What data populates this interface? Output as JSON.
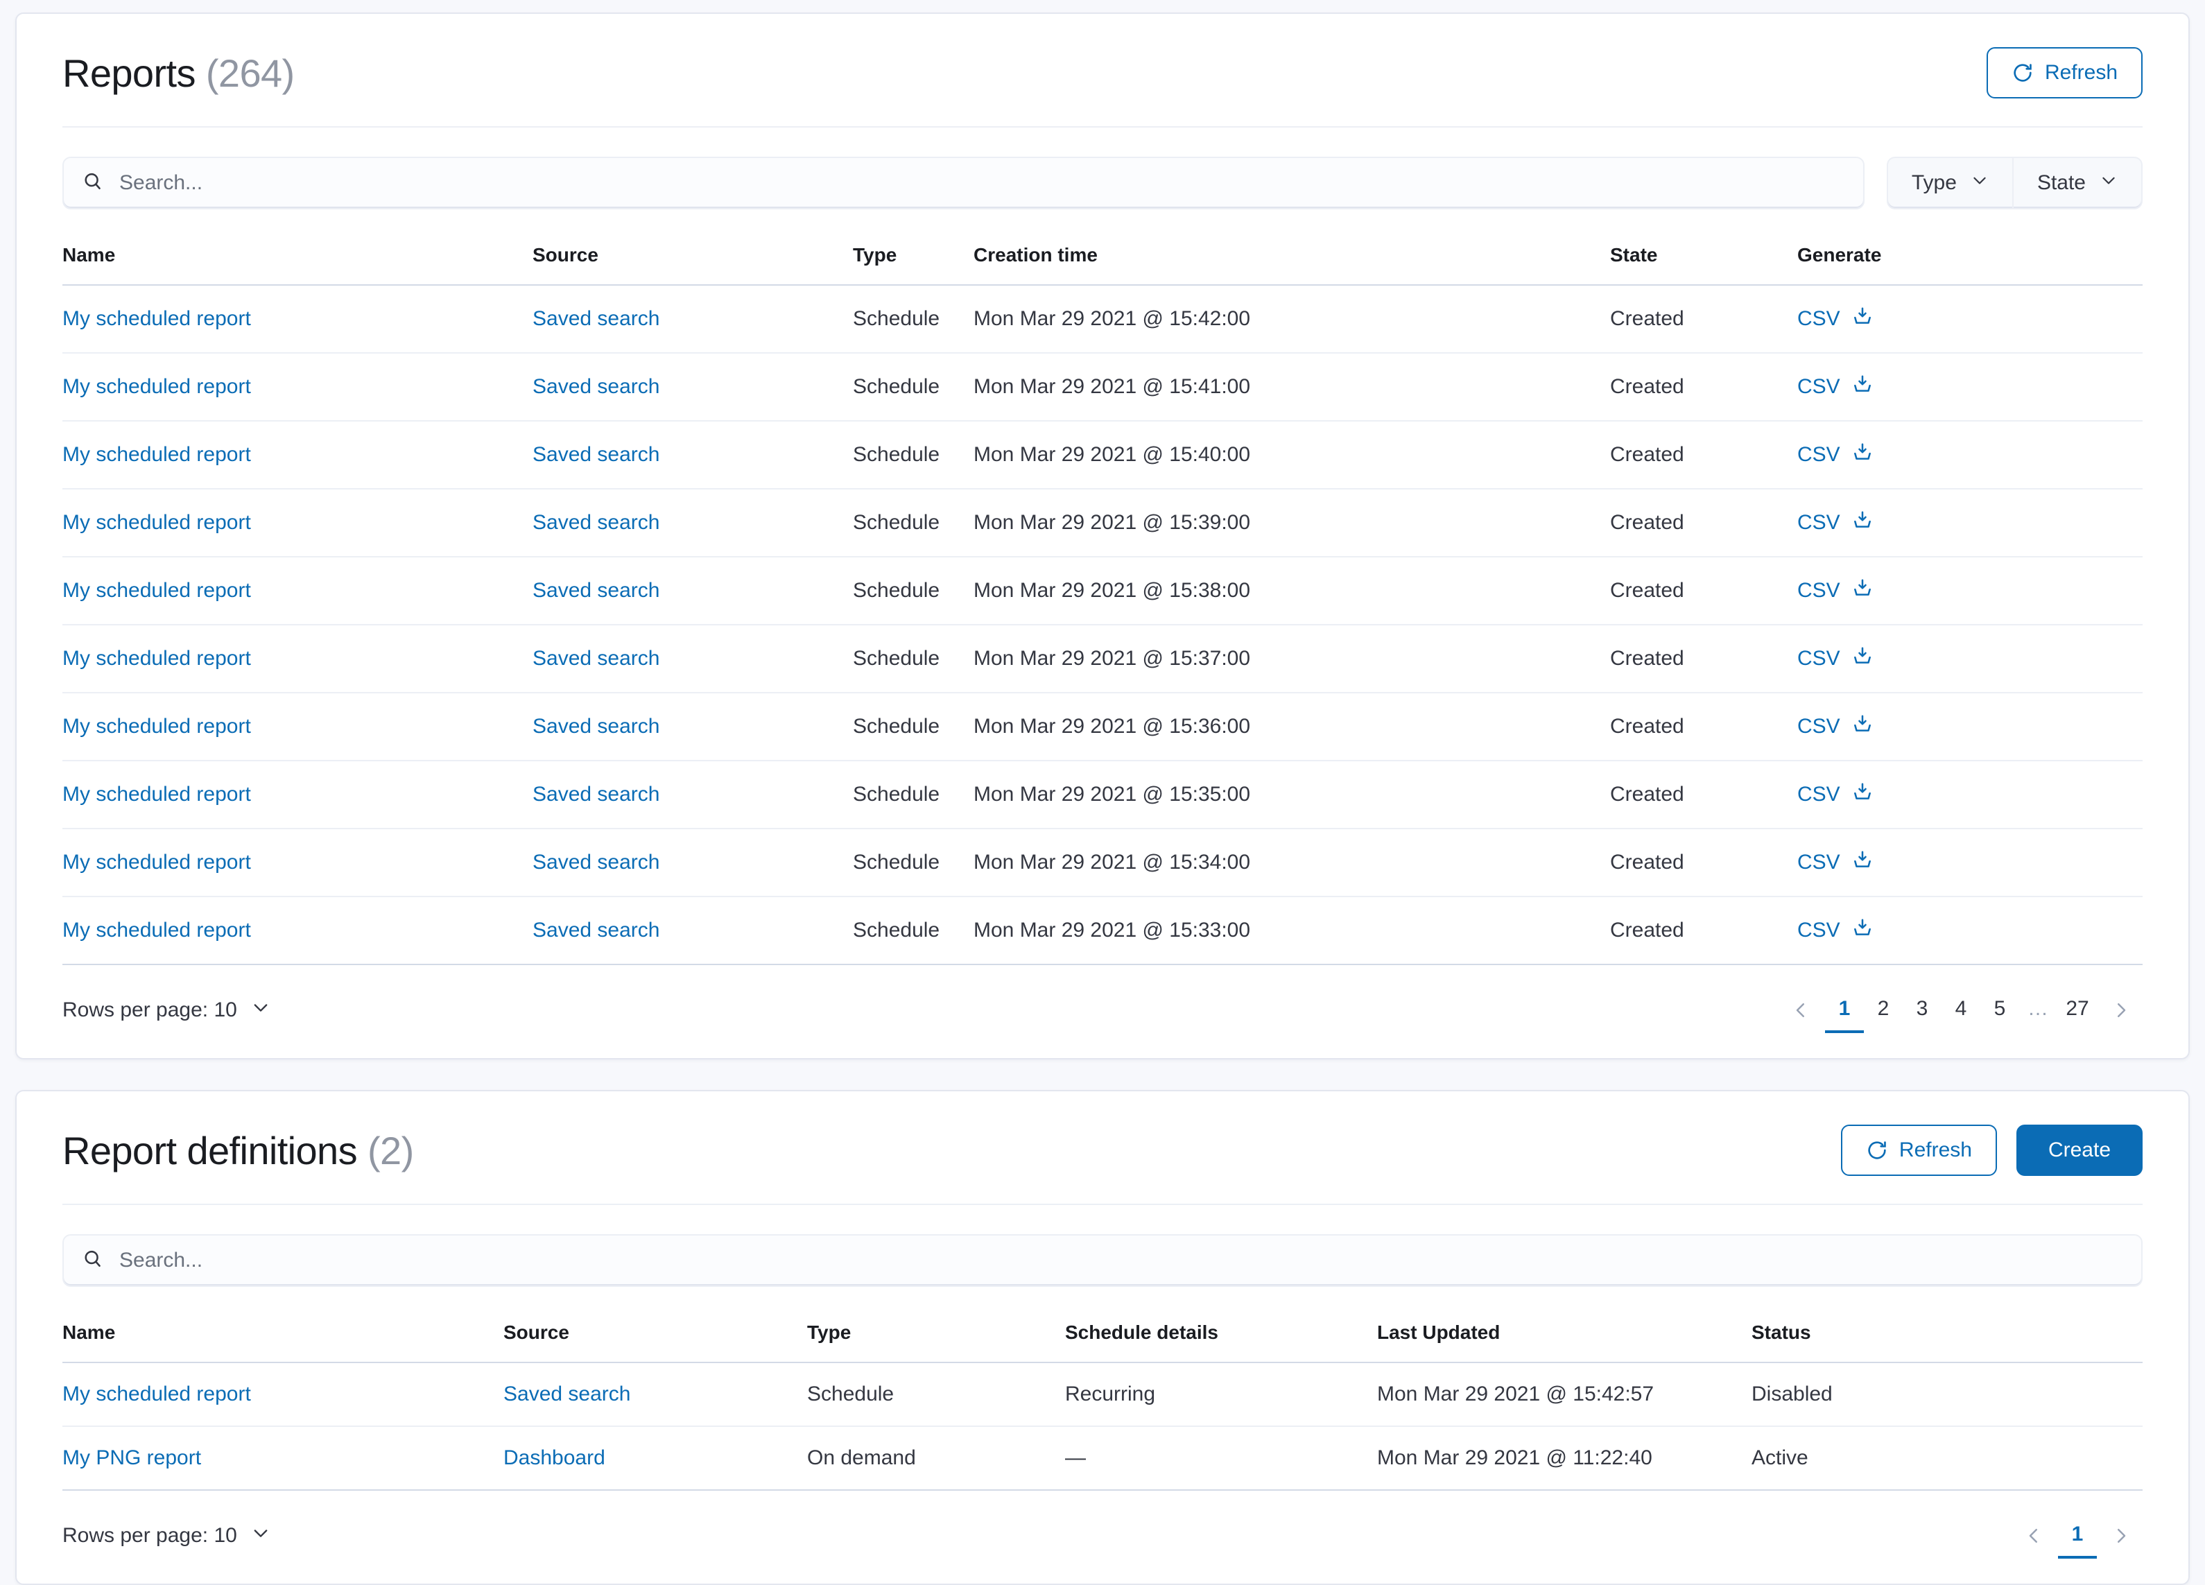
{
  "reports_panel": {
    "title": "Reports",
    "count": "(264)",
    "refresh_label": "Refresh",
    "search": {
      "placeholder": "Search..."
    },
    "filters": [
      {
        "label": "Type"
      },
      {
        "label": "State"
      }
    ],
    "table": {
      "headers": [
        "Name",
        "Source",
        "Type",
        "Creation time",
        "State",
        "Generate"
      ],
      "rows": [
        {
          "name": "My scheduled report",
          "source": "Saved search",
          "type": "Schedule",
          "creation_time": "Mon Mar 29 2021 @ 15:42:00",
          "state": "Created",
          "generate": "CSV"
        },
        {
          "name": "My scheduled report",
          "source": "Saved search",
          "type": "Schedule",
          "creation_time": "Mon Mar 29 2021 @ 15:41:00",
          "state": "Created",
          "generate": "CSV"
        },
        {
          "name": "My scheduled report",
          "source": "Saved search",
          "type": "Schedule",
          "creation_time": "Mon Mar 29 2021 @ 15:40:00",
          "state": "Created",
          "generate": "CSV"
        },
        {
          "name": "My scheduled report",
          "source": "Saved search",
          "type": "Schedule",
          "creation_time": "Mon Mar 29 2021 @ 15:39:00",
          "state": "Created",
          "generate": "CSV"
        },
        {
          "name": "My scheduled report",
          "source": "Saved search",
          "type": "Schedule",
          "creation_time": "Mon Mar 29 2021 @ 15:38:00",
          "state": "Created",
          "generate": "CSV"
        },
        {
          "name": "My scheduled report",
          "source": "Saved search",
          "type": "Schedule",
          "creation_time": "Mon Mar 29 2021 @ 15:37:00",
          "state": "Created",
          "generate": "CSV"
        },
        {
          "name": "My scheduled report",
          "source": "Saved search",
          "type": "Schedule",
          "creation_time": "Mon Mar 29 2021 @ 15:36:00",
          "state": "Created",
          "generate": "CSV"
        },
        {
          "name": "My scheduled report",
          "source": "Saved search",
          "type": "Schedule",
          "creation_time": "Mon Mar 29 2021 @ 15:35:00",
          "state": "Created",
          "generate": "CSV"
        },
        {
          "name": "My scheduled report",
          "source": "Saved search",
          "type": "Schedule",
          "creation_time": "Mon Mar 29 2021 @ 15:34:00",
          "state": "Created",
          "generate": "CSV"
        },
        {
          "name": "My scheduled report",
          "source": "Saved search",
          "type": "Schedule",
          "creation_time": "Mon Mar 29 2021 @ 15:33:00",
          "state": "Created",
          "generate": "CSV"
        }
      ]
    },
    "footer": {
      "rows_per_page_label": "Rows per page: 10",
      "pages": [
        "1",
        "2",
        "3",
        "4",
        "5",
        "…",
        "27"
      ],
      "active_page": "1"
    }
  },
  "definitions_panel": {
    "title": "Report definitions",
    "count": "(2)",
    "refresh_label": "Refresh",
    "create_label": "Create",
    "search": {
      "placeholder": "Search..."
    },
    "table": {
      "headers": [
        "Name",
        "Source",
        "Type",
        "Schedule details",
        "Last Updated",
        "Status"
      ],
      "rows": [
        {
          "name": "My scheduled report",
          "source": "Saved search",
          "type": "Schedule",
          "schedule_details": "Recurring",
          "last_updated": "Mon Mar 29 2021 @ 15:42:57",
          "status": "Disabled"
        },
        {
          "name": "My PNG report",
          "source": "Dashboard",
          "type": "On demand",
          "schedule_details": "—",
          "last_updated": "Mon Mar 29 2021 @ 11:22:40",
          "status": "Active"
        }
      ]
    },
    "footer": {
      "rows_per_page_label": "Rows per page: 10",
      "pages": [
        "1"
      ],
      "active_page": "1"
    }
  },
  "colors": {
    "link": "#0b6cb5",
    "primary": "#0b6cb5",
    "text": "#343741",
    "muted": "#9096a2",
    "panel_border": "#e3e6ef",
    "background": "#f7f8fc"
  }
}
